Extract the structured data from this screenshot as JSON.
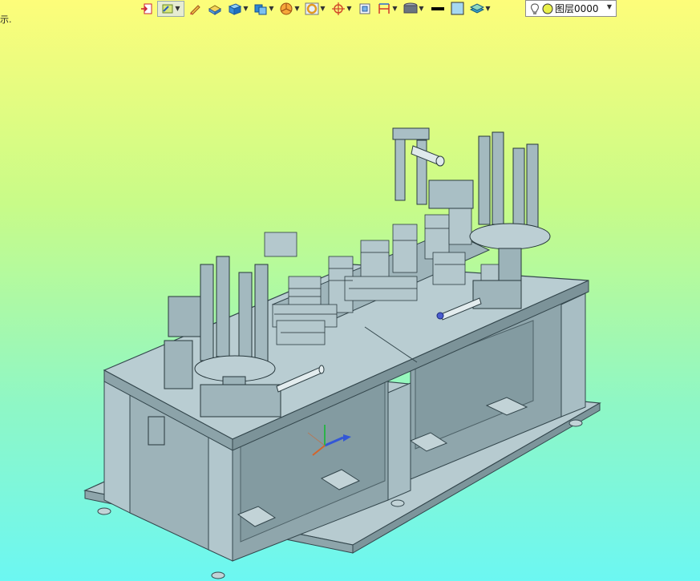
{
  "viewport": {
    "corner_text": "示.",
    "background_top": "#fdfd7a",
    "background_bottom": "#6cf7f2"
  },
  "toolbar": {
    "items": [
      {
        "name": "exit-sketch-icon"
      },
      {
        "name": "sketch-mode-icon",
        "dropdown": true
      },
      {
        "name": "pencil-icon"
      },
      {
        "name": "extrude-icon"
      },
      {
        "name": "solid-box-icon",
        "dropdown": true
      },
      {
        "name": "part-copy-icon",
        "dropdown": true
      },
      {
        "name": "pie-section-icon",
        "dropdown": true
      },
      {
        "name": "ring-view-icon",
        "dropdown": true
      },
      {
        "name": "axis-cross-icon",
        "dropdown": true
      },
      {
        "name": "fit-frame-icon"
      },
      {
        "name": "dimension-icon",
        "dropdown": true
      },
      {
        "name": "shading-icon",
        "dropdown": true
      },
      {
        "name": "line-color-icon"
      },
      {
        "name": "fill-color-icon"
      },
      {
        "name": "layer-stack-icon",
        "dropdown": true
      }
    ]
  },
  "layer": {
    "label": "图层0000",
    "icons": [
      "bulb-icon",
      "layer-color-dot-icon"
    ]
  },
  "model": {
    "body_color": "#a6bcc3",
    "dark_color": "#4e6168",
    "frame_color": "#b7cbd0"
  }
}
